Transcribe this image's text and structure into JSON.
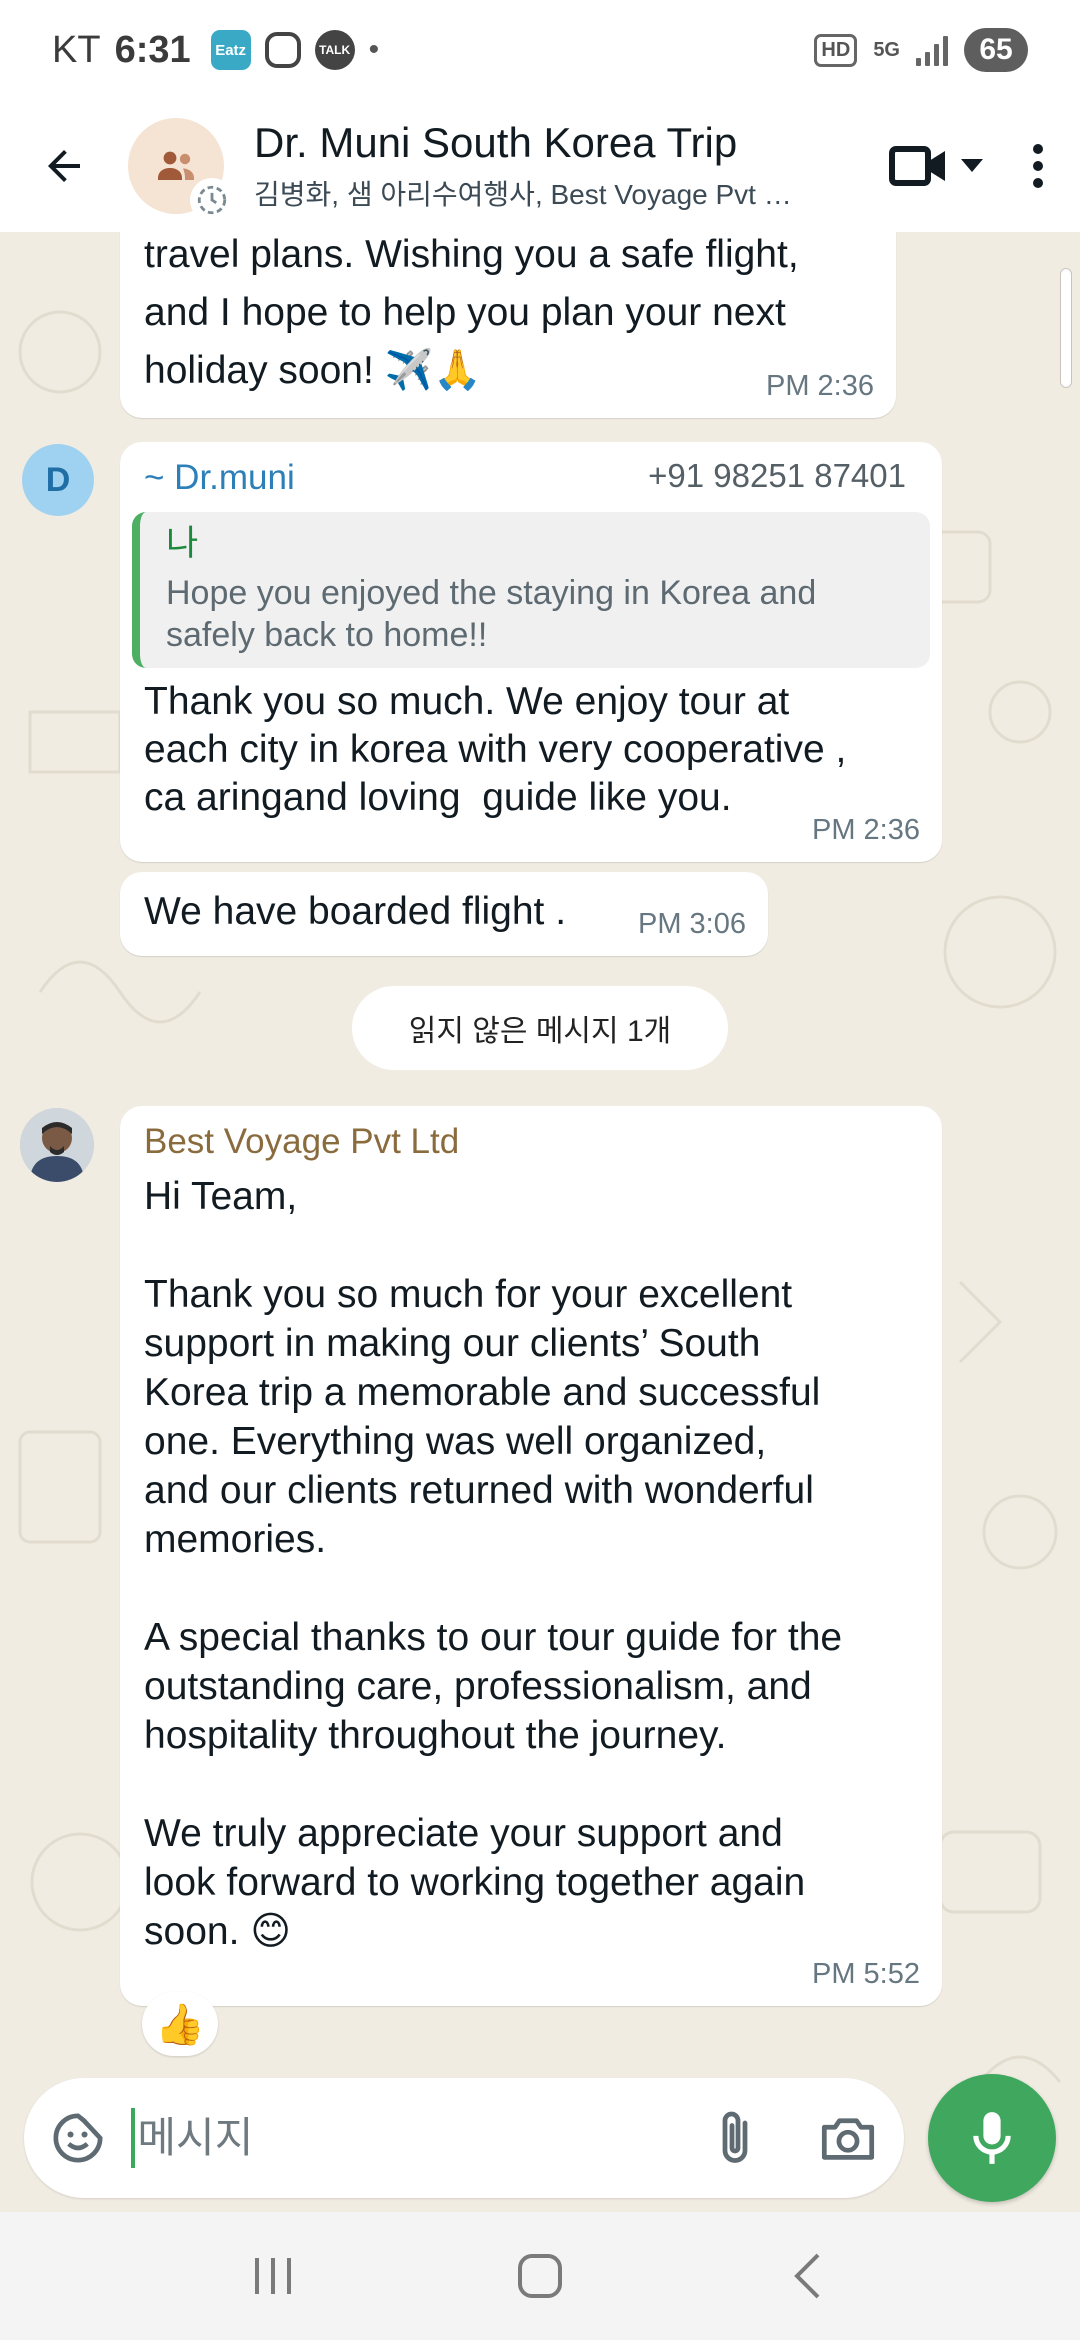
{
  "status_bar": {
    "carrier": "KT",
    "time": "6:31",
    "eatz_icon_label": "Eatz",
    "talk_icon_label": "TALK",
    "hd_label": "HD",
    "network_label": "5G",
    "battery": "65"
  },
  "header": {
    "title": "Dr. Muni South Korea Trip",
    "subtitle": "김병화, 샘 아리수여행사, Best Voyage Pvt Ltd"
  },
  "messages": {
    "m1": {
      "text": "travel plans. Wishing you a safe flight,\nand I hope to help you plan your next\nholiday soon! ✈️🙏",
      "time": "PM 2:36"
    },
    "m2": {
      "avatar_letter": "D",
      "sender": "~ Dr.muni",
      "phone": "+91 98251 87401",
      "quote_author": "나",
      "quote_text": "Hope you enjoyed the staying in Korea and safely back to home!!",
      "text": "Thank you so much. We enjoy tour at\neach city in korea with very cooperative ,\nca aringand loving  guide like you.",
      "time": "PM 2:36"
    },
    "m3": {
      "text": "We have boarded flight .",
      "time": "PM 3:06"
    },
    "unread_label": "읽지 않은 메시지 1개",
    "m4": {
      "sender": "Best Voyage Pvt Ltd",
      "text": "Hi Team,\n\nThank you so much for your excellent\nsupport in making our clients’ South\nKorea trip a memorable and successful\none. Everything was well organized,\nand our clients returned with wonderful\nmemories.\n\nA special thanks to our tour guide for the\noutstanding care, professionalism, and\nhospitality throughout the journey.\n\nWe truly appreciate your support and\nlook forward to working together again\nsoon. 😊",
      "time": "PM 5:52",
      "reaction": "👍"
    }
  },
  "input": {
    "placeholder": "메시지",
    "value": ""
  },
  "colors": {
    "accent_green": "#3fa85e",
    "drmuni_name": "#2c7fb8",
    "bestvoyage_name": "#8a6b3d"
  }
}
